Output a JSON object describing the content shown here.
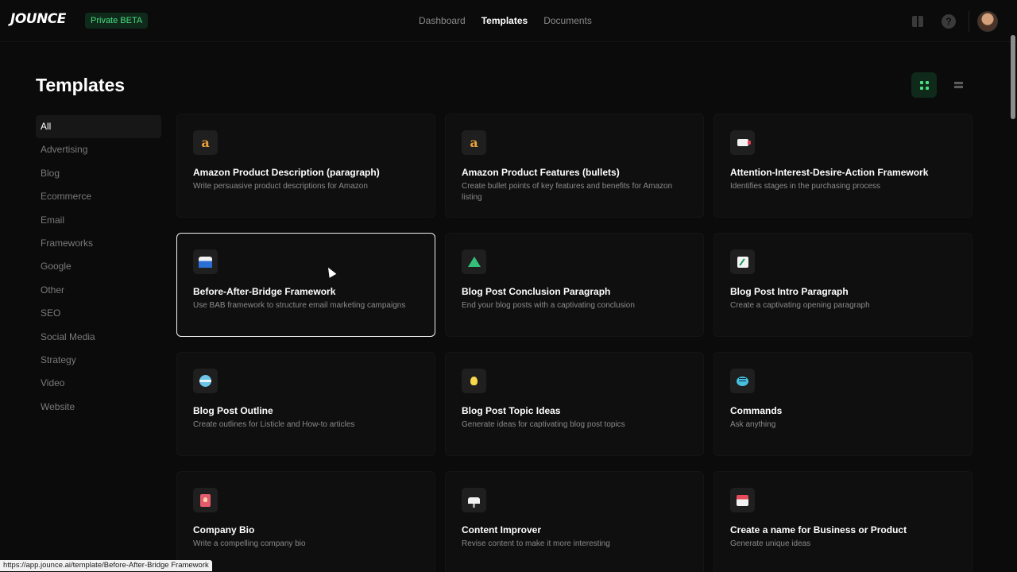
{
  "header": {
    "logo": "JOUNCE",
    "badge": "Private BETA",
    "nav": [
      {
        "label": "Dashboard",
        "active": false
      },
      {
        "label": "Templates",
        "active": true
      },
      {
        "label": "Documents",
        "active": false
      }
    ],
    "icons": [
      "gift-icon",
      "help-icon",
      "avatar"
    ],
    "help_glyph": "?"
  },
  "page": {
    "title": "Templates",
    "view": "grid"
  },
  "sidebar": {
    "categories": [
      "All",
      "Advertising",
      "Blog",
      "Ecommerce",
      "Email",
      "Frameworks",
      "Google",
      "Other",
      "SEO",
      "Social Media",
      "Strategy",
      "Video",
      "Website"
    ],
    "active": "All"
  },
  "cards": [
    {
      "title": "Amazon Product Description (paragraph)",
      "desc": "Write persuasive product descriptions for Amazon",
      "icon": "amazon-icon",
      "glyph": "a"
    },
    {
      "title": "Amazon Product Features (bullets)",
      "desc": "Create bullet points of key features and benefits for Amazon listing",
      "icon": "amazon-icon",
      "glyph": "a"
    },
    {
      "title": "Attention-Interest-Desire-Action Framework",
      "desc": "Identifies stages in the purchasing process",
      "icon": "megaphone-icon"
    },
    {
      "title": "Before-After-Bridge Framework",
      "desc": "Use BAB framework to structure email marketing campaigns",
      "icon": "bridge-icon",
      "selected": true
    },
    {
      "title": "Blog Post Conclusion Paragraph",
      "desc": "End your blog posts with a captivating conclusion",
      "icon": "mountain-flag-icon"
    },
    {
      "title": "Blog Post Intro Paragraph",
      "desc": "Create a captivating opening paragraph",
      "icon": "notepad-icon"
    },
    {
      "title": "Blog Post Outline",
      "desc": "Create outlines for Listicle and How-to articles",
      "icon": "globe-icon"
    },
    {
      "title": "Blog Post Topic Ideas",
      "desc": "Generate ideas for captivating blog post topics",
      "icon": "lightbulb-icon"
    },
    {
      "title": "Commands",
      "desc": "Ask anything",
      "icon": "speech-bubble-icon"
    },
    {
      "title": "Company Bio",
      "desc": "Write a compelling company bio",
      "icon": "id-badge-icon"
    },
    {
      "title": "Content Improver",
      "desc": "Revise content to make it more interesting",
      "icon": "brush-icon"
    },
    {
      "title": "Create a name for Business or Product",
      "desc": "Generate unique ideas",
      "icon": "shop-icon"
    }
  ],
  "status_url": "https://app.jounce.ai/template/Before-After-Bridge Framework",
  "colors": {
    "background": "#0b0b0b",
    "accent": "#4ade80",
    "card": "#0f0f0f"
  }
}
